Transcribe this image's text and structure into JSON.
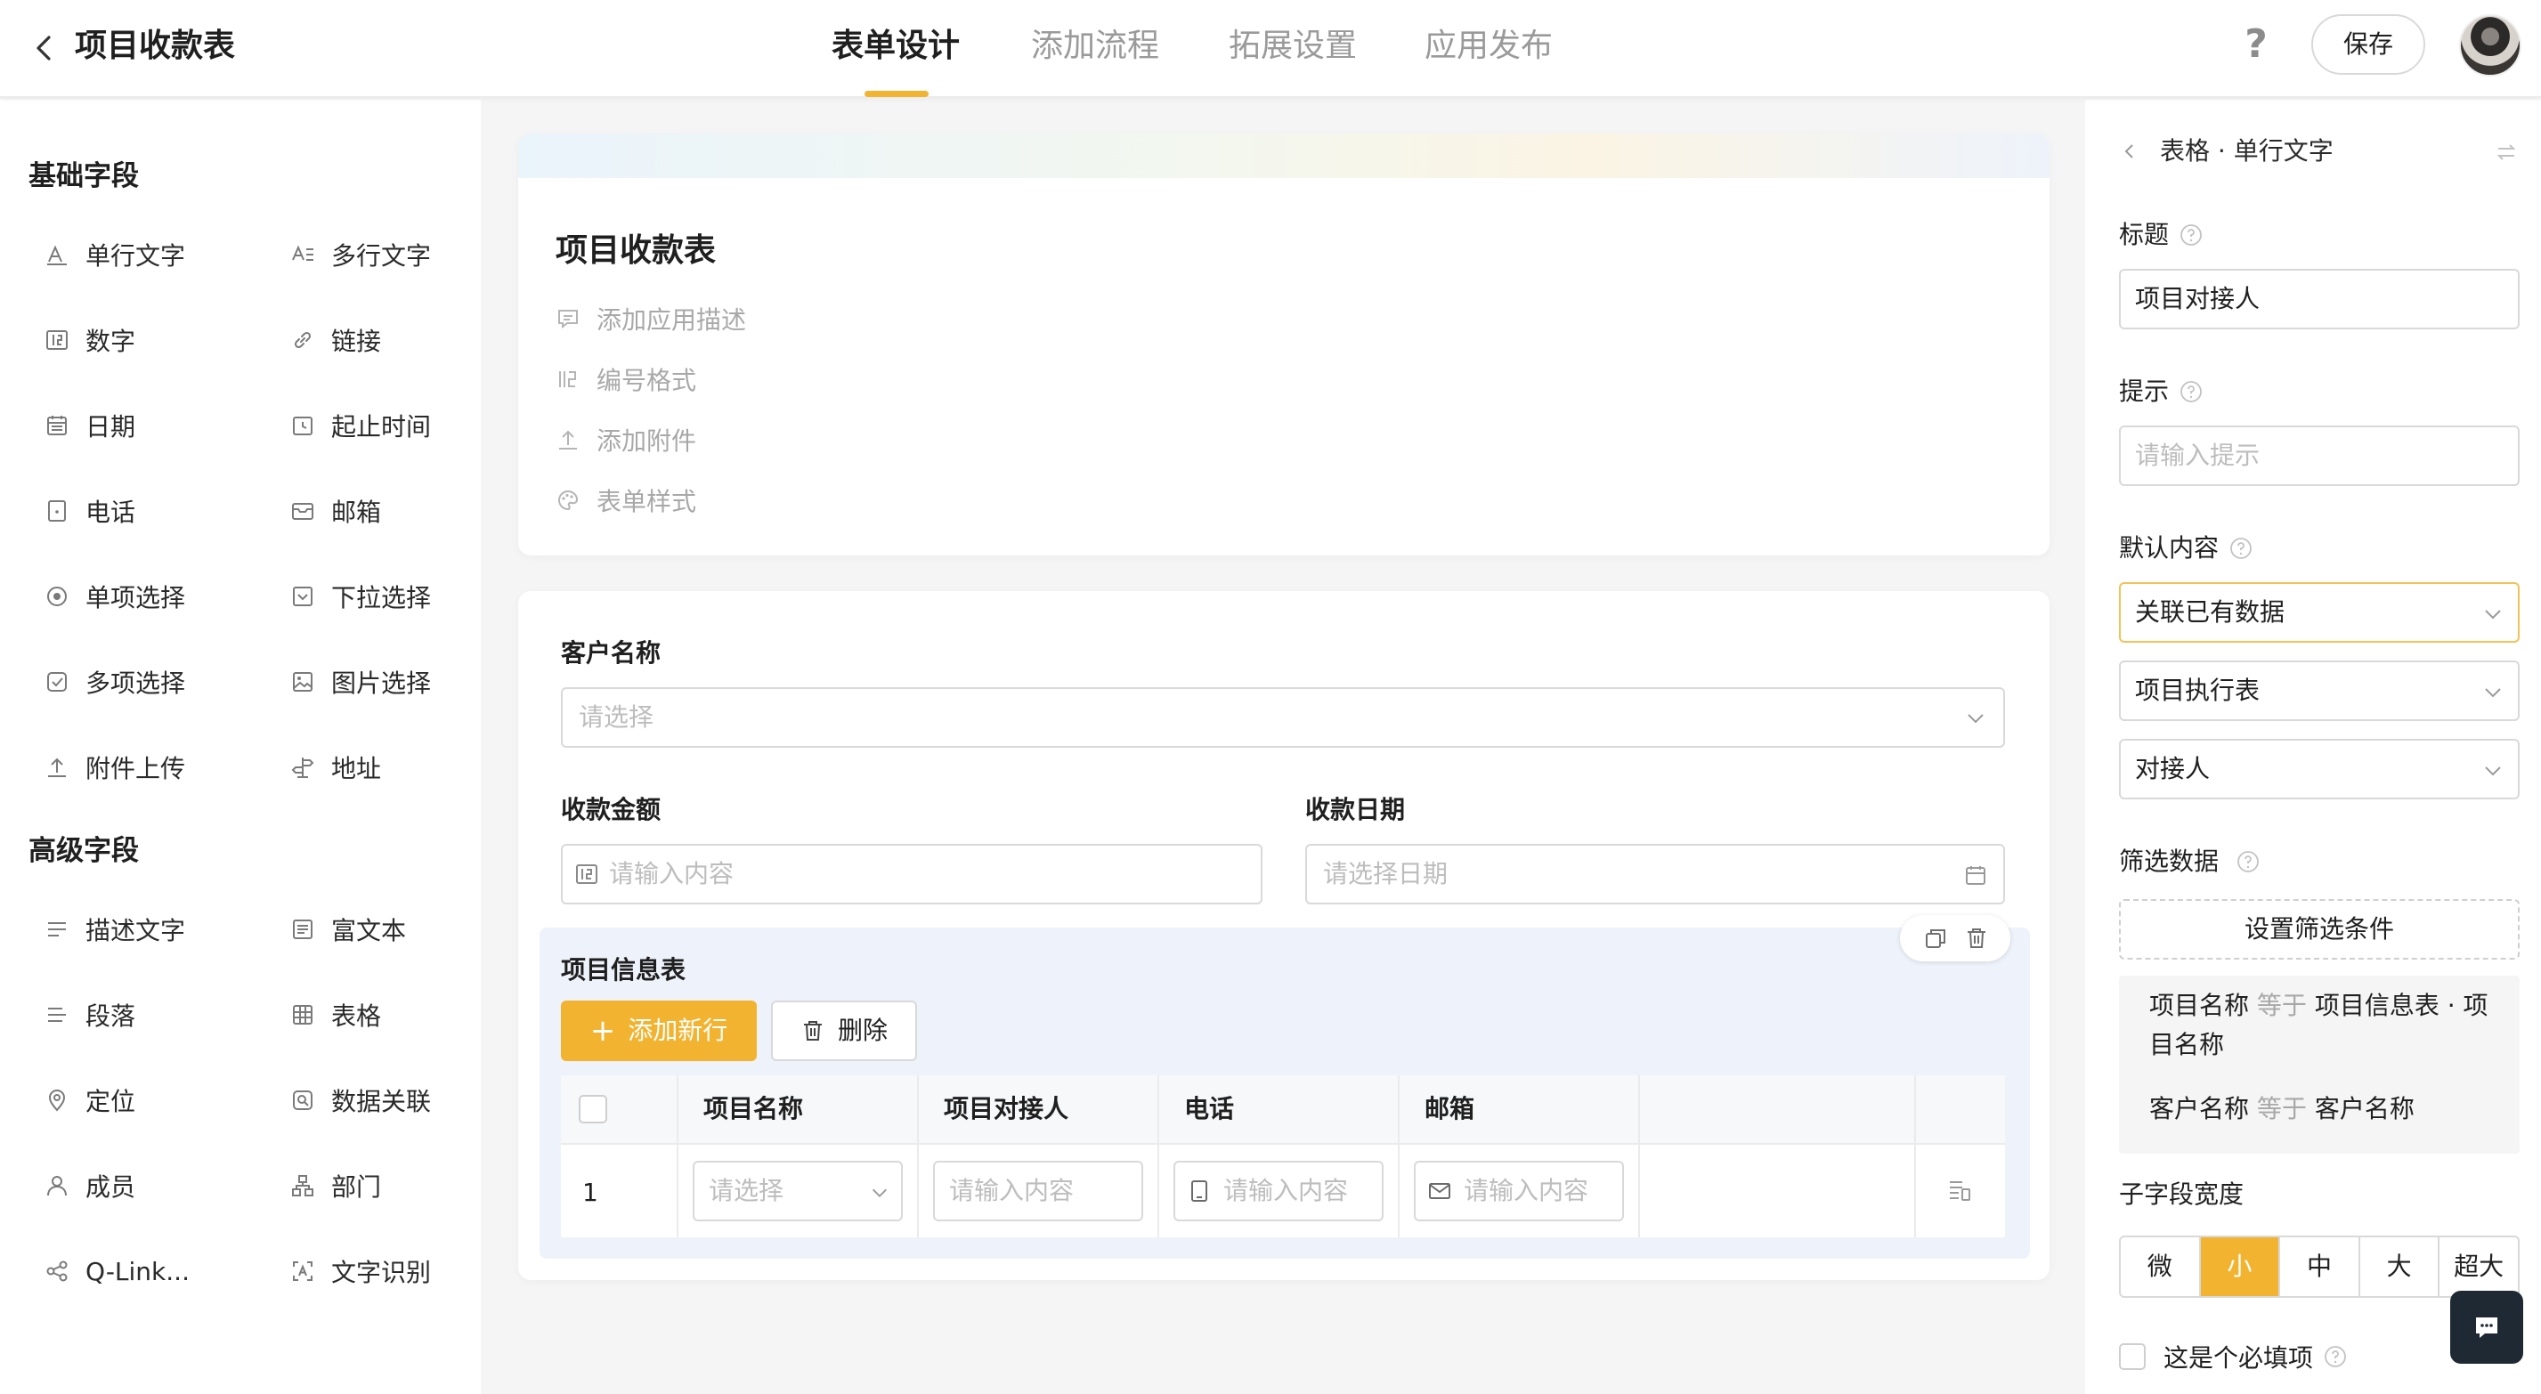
{
  "header": {
    "title": "项目收款表",
    "tabs": [
      "表单设计",
      "添加流程",
      "拓展设置",
      "应用发布"
    ],
    "active_tab": "表单设计",
    "save_label": "保存",
    "help_symbol": "?"
  },
  "left_panel": {
    "basic_title": "基础字段",
    "basic_fields": [
      "单行文字",
      "多行文字",
      "数字",
      "链接",
      "日期",
      "起止时间",
      "电话",
      "邮箱",
      "单项选择",
      "下拉选择",
      "多项选择",
      "图片选择",
      "附件上传",
      "地址"
    ],
    "advanced_title": "高级字段",
    "advanced_fields": [
      "描述文字",
      "富文本",
      "段落",
      "表格",
      "定位",
      "数据关联",
      "成员",
      "部门",
      "Q-Link...",
      "文字识别"
    ]
  },
  "form_card": {
    "title": "项目收款表",
    "actions": [
      "添加应用描述",
      "编号格式",
      "添加附件",
      "表单样式"
    ]
  },
  "fields": {
    "customer_label": "客户名称",
    "customer_placeholder": "请选择",
    "amount_label": "收款金额",
    "amount_placeholder": "请输入内容",
    "date_label": "收款日期",
    "date_placeholder": "请选择日期"
  },
  "subform": {
    "title": "项目信息表",
    "add_row_label": "添加新行",
    "delete_label": "删除",
    "columns": [
      "项目名称",
      "项目对接人",
      "电话",
      "邮箱"
    ],
    "row_index": "1",
    "cell_placeholders": [
      "请选择",
      "请输入内容",
      "请输入内容",
      "请输入内容"
    ]
  },
  "right_panel": {
    "breadcrumb": "表格 · 单行文字",
    "title_label": "标题",
    "title_value": "项目对接人",
    "hint_label": "提示",
    "hint_placeholder": "请输入提示",
    "default_label": "默认内容",
    "default_mode": "关联已有数据",
    "default_source": "项目执行表",
    "default_field": "对接人",
    "filter_label": "筛选数据",
    "filter_button": "设置筛选条件",
    "filters": [
      {
        "field": "项目名称",
        "op": "等于",
        "value": "项目信息表 · 项目名称"
      },
      {
        "field": "客户名称",
        "op": "等于",
        "value": "客户名称"
      }
    ],
    "width_label": "子字段宽度",
    "width_options": [
      "微",
      "小",
      "中",
      "大",
      "超大"
    ],
    "width_selected": "小",
    "required_label": "这是个必填项"
  },
  "colors": {
    "accent": "#f2b430",
    "chat_button": "#1f2933"
  }
}
